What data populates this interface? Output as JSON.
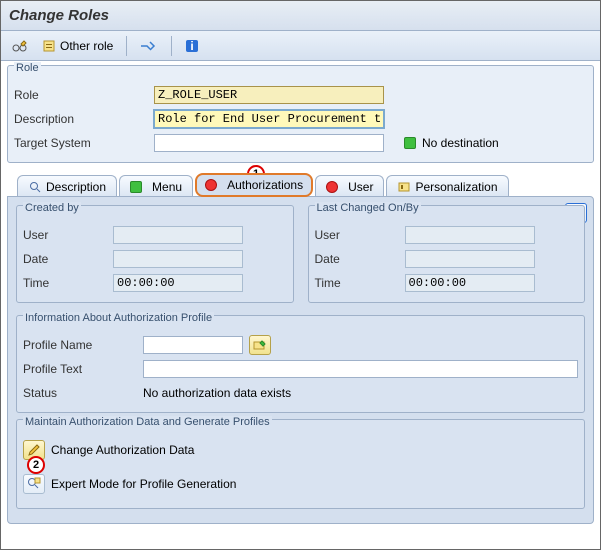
{
  "window": {
    "title": "Change Roles"
  },
  "toolbar": {
    "other_role": "Other role"
  },
  "role_box": {
    "legend": "Role",
    "role_label": "Role",
    "role_value": "Z_ROLE_USER",
    "desc_label": "Description",
    "desc_value": "Role for End User Procurement team",
    "target_label": "Target System",
    "target_value": "",
    "no_dest": "No destination"
  },
  "tabs": {
    "description": "Description",
    "menu": "Menu",
    "authorizations": "Authorizations",
    "user": "User",
    "personalization": "Personalization"
  },
  "callouts": {
    "one": "1",
    "two": "2"
  },
  "created": {
    "legend": "Created by",
    "user_label": "User",
    "user_value": "",
    "date_label": "Date",
    "date_value": "",
    "time_label": "Time",
    "time_value": "00:00:00"
  },
  "changed": {
    "legend": "Last Changed On/By",
    "user_label": "User",
    "user_value": "",
    "date_label": "Date",
    "date_value": "",
    "time_label": "Time",
    "time_value": "00:00:00"
  },
  "profile": {
    "legend": "Information About Authorization Profile",
    "name_label": "Profile Name",
    "name_value": "",
    "text_label": "Profile Text",
    "text_value": "",
    "status_label": "Status",
    "status_value": "No authorization data exists"
  },
  "maintain": {
    "legend": "Maintain Authorization Data and Generate Profiles",
    "change_auth": "Change Authorization Data",
    "expert_mode": "Expert Mode for Profile Generation"
  }
}
